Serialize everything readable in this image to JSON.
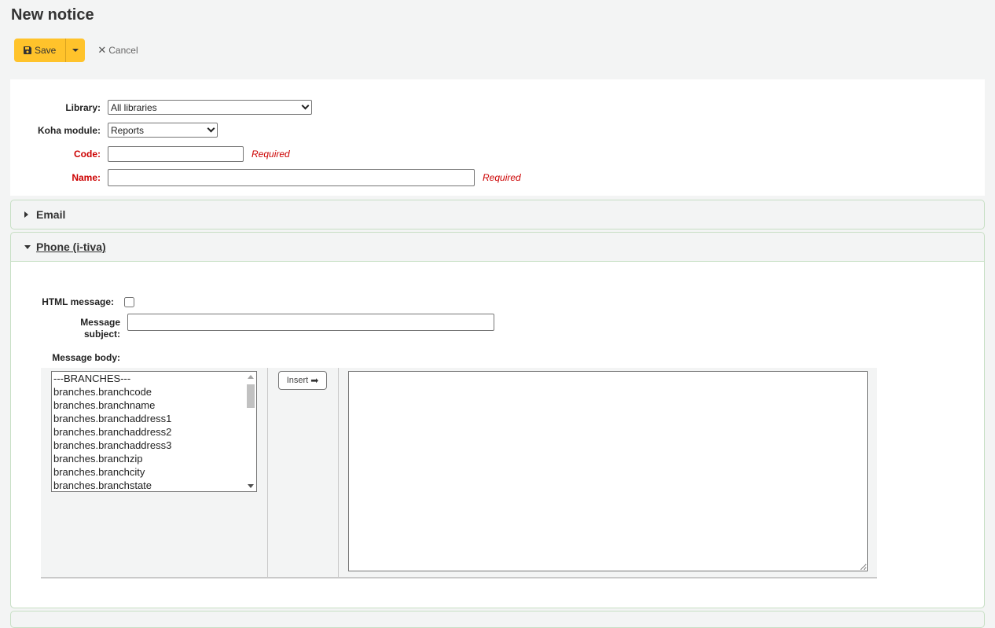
{
  "page": {
    "title": "New notice"
  },
  "toolbar": {
    "save_label": "Save",
    "cancel_label": "Cancel"
  },
  "form": {
    "library": {
      "label": "Library:",
      "value": "All libraries"
    },
    "module": {
      "label": "Koha module:",
      "value": "Reports"
    },
    "code": {
      "label": "Code:",
      "value": "",
      "required": "Required"
    },
    "name": {
      "label": "Name:",
      "value": "",
      "required": "Required"
    }
  },
  "sections": [
    {
      "label": "Email",
      "expanded": false
    },
    {
      "label": "Phone (i-tiva)",
      "expanded": true
    }
  ],
  "phone": {
    "html_message_label": "HTML message:",
    "html_message_checked": false,
    "subject_label_1": "Message",
    "subject_label_2": "subject:",
    "subject_value": "",
    "body_label": "Message body:",
    "insert_label": "Insert",
    "body_value": "",
    "fields": [
      "---BRANCHES---",
      "branches.branchcode",
      "branches.branchname",
      "branches.branchaddress1",
      "branches.branchaddress2",
      "branches.branchaddress3",
      "branches.branchzip",
      "branches.branchcity",
      "branches.branchstate"
    ]
  },
  "colors": {
    "save_button": "#ffc32b",
    "required": "#cc0000",
    "accordion_border": "#c7dfc4"
  }
}
